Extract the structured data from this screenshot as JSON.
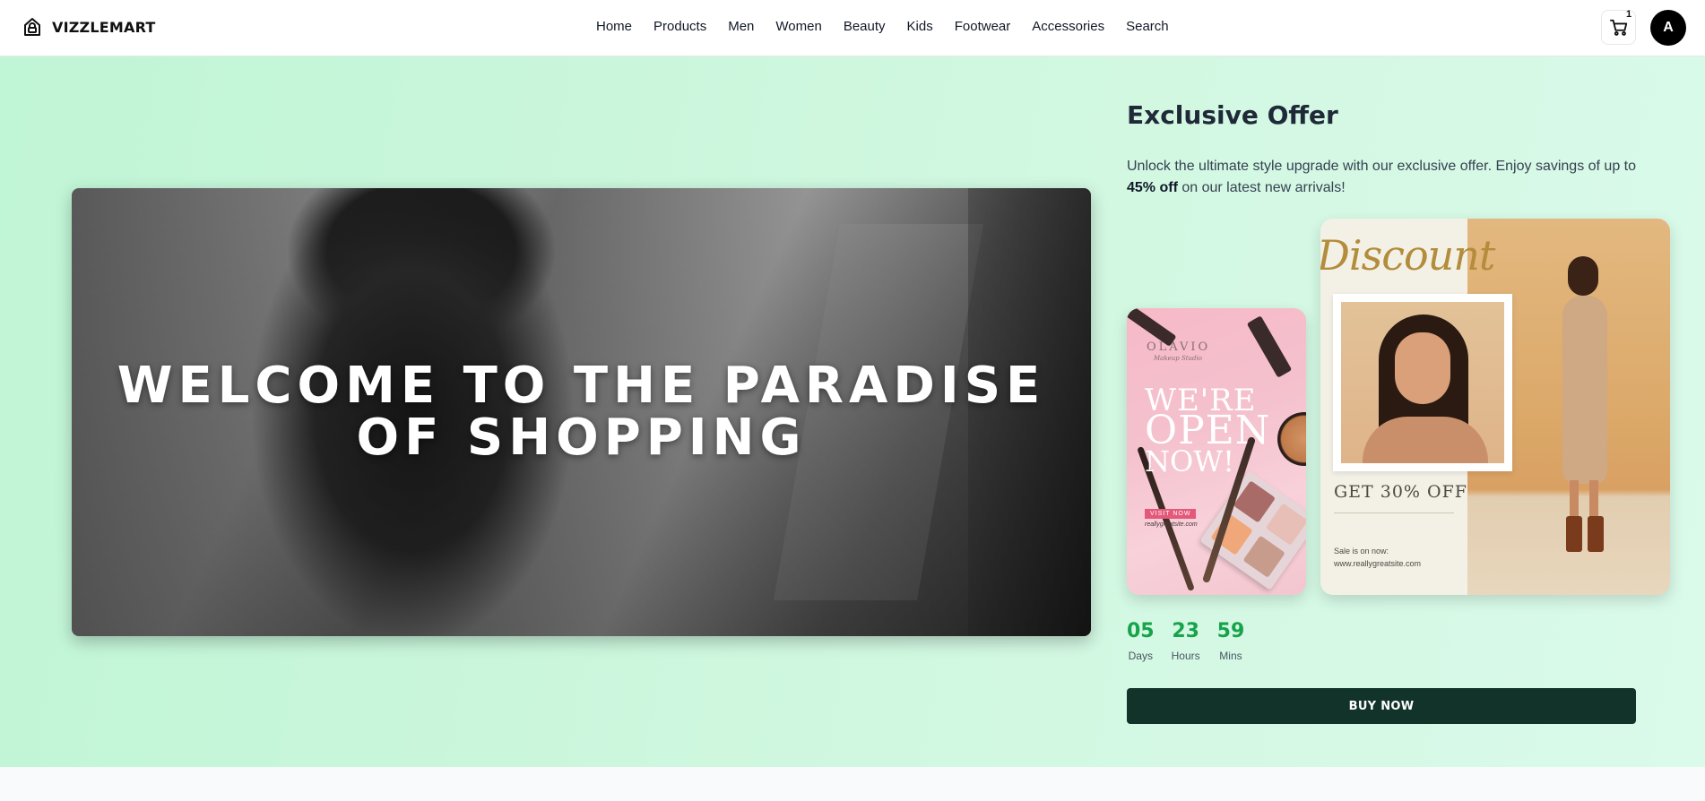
{
  "brand": {
    "name": "VIZZLEMART"
  },
  "nav": {
    "links": [
      "Home",
      "Products",
      "Men",
      "Women",
      "Beauty",
      "Kids",
      "Footwear",
      "Accessories",
      "Search"
    ]
  },
  "header": {
    "cart_count": "1",
    "avatar_initial": "A"
  },
  "hero": {
    "title_line1": "WELCOME TO THE PARADISE",
    "title_line2": "OF SHOPPING",
    "background_color": "#c0f5d5"
  },
  "offer": {
    "title": "Exclusive Offer",
    "desc_before": "Unlock the ultimate style upgrade with our exclusive offer. Enjoy savings of up to ",
    "desc_bold": "45% off",
    "desc_after": " on our latest new arrivals!",
    "pink_card": {
      "brand": "OLAVIO",
      "brand_sub": "Makeup Studio",
      "line1": "WE'RE",
      "line2": "OPEN",
      "line3": "NOW!",
      "visit": "VISIT NOW",
      "website": "reallygreatsite.com"
    },
    "discount_card": {
      "script": "Discount",
      "headline": "GET 30% OFF",
      "sale_line1": "Sale is on now:",
      "sale_line2": "www.reallygreatsite.com"
    },
    "countdown": [
      {
        "value": "05",
        "label": "Days"
      },
      {
        "value": "23",
        "label": "Hours"
      },
      {
        "value": "59",
        "label": "Mins"
      }
    ],
    "cta": "BUY NOW",
    "accent_color": "#16a34a",
    "button_color": "#123329"
  }
}
